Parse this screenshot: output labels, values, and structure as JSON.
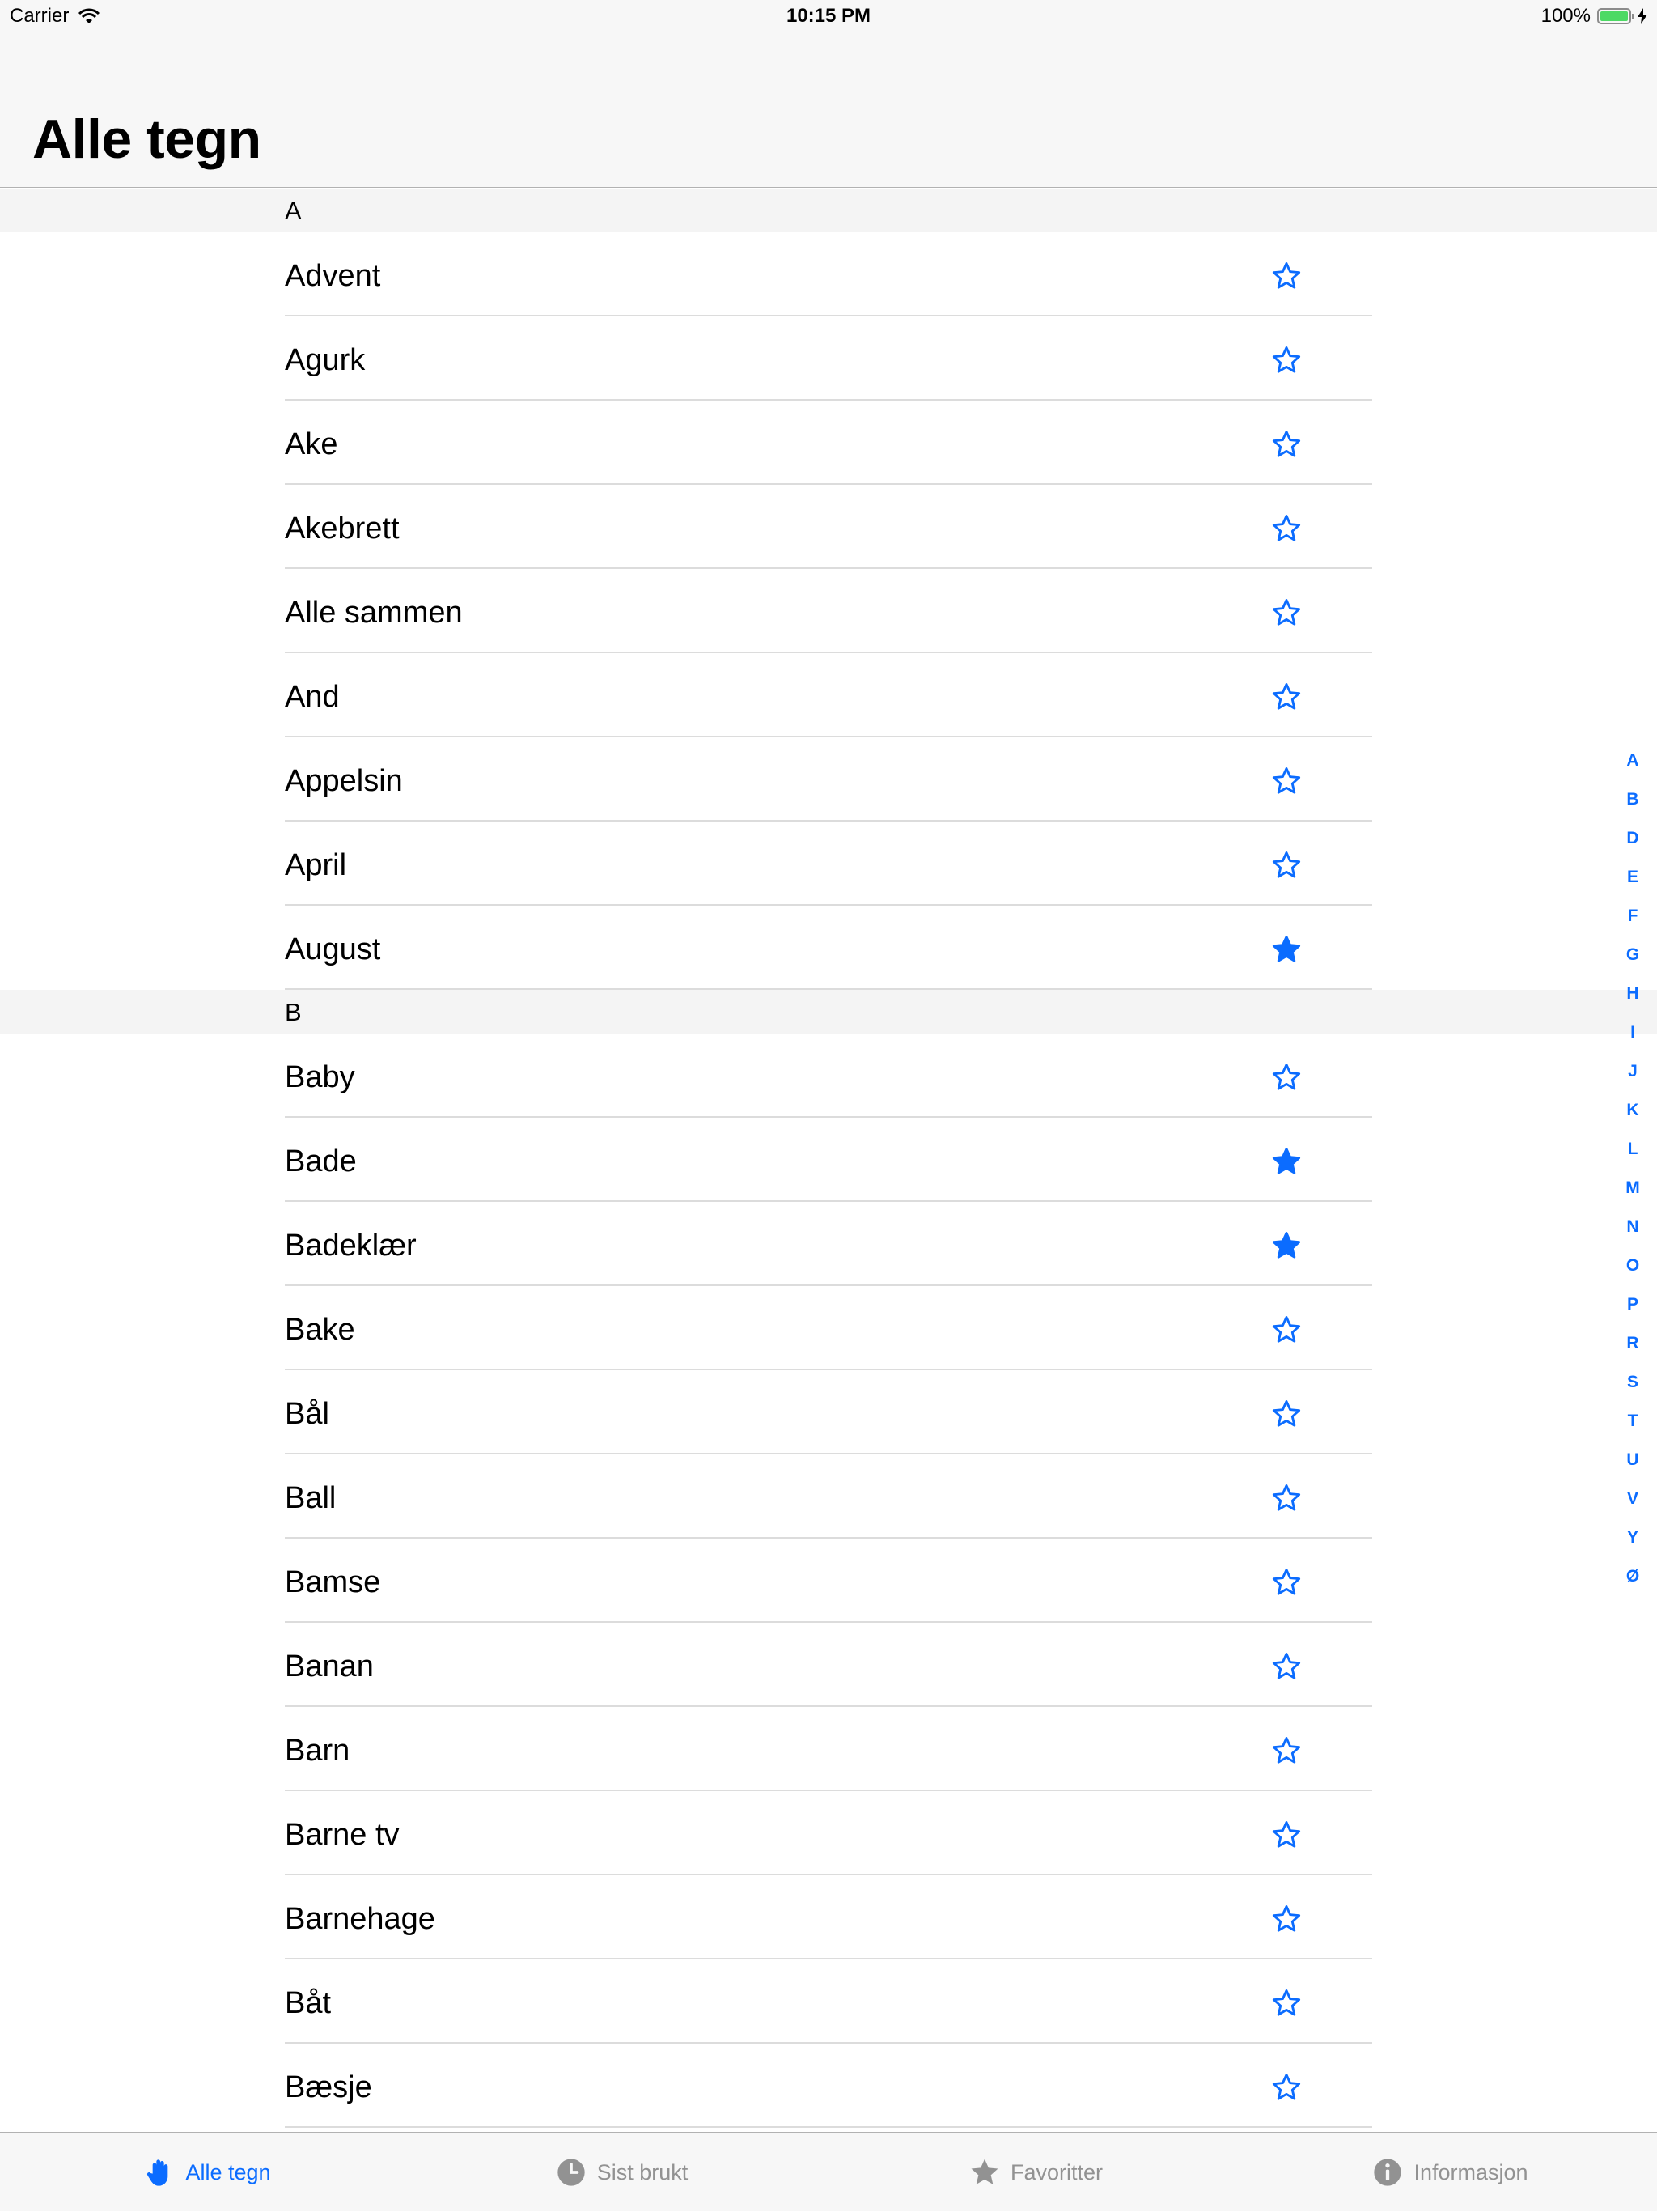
{
  "status_bar": {
    "carrier": "Carrier",
    "time": "10:15 PM",
    "battery": "100%",
    "battery_level": 1.0
  },
  "nav": {
    "title": "Alle tegn"
  },
  "colors": {
    "accent": "#0b6cff",
    "battery": "#4cd964",
    "separator": "#dcdcdc",
    "section_bg": "#f4f4f4"
  },
  "sections": [
    {
      "letter": "A",
      "items": [
        {
          "label": "Advent",
          "favorite": false
        },
        {
          "label": "Agurk",
          "favorite": false
        },
        {
          "label": "Ake",
          "favorite": false
        },
        {
          "label": "Akebrett",
          "favorite": false
        },
        {
          "label": "Alle sammen",
          "favorite": false
        },
        {
          "label": "And",
          "favorite": false
        },
        {
          "label": "Appelsin",
          "favorite": false
        },
        {
          "label": "April",
          "favorite": false
        },
        {
          "label": "August",
          "favorite": true
        }
      ]
    },
    {
      "letter": "B",
      "items": [
        {
          "label": "Baby",
          "favorite": false
        },
        {
          "label": "Bade",
          "favorite": true
        },
        {
          "label": "Badeklær",
          "favorite": true
        },
        {
          "label": "Bake",
          "favorite": false
        },
        {
          "label": "Bål",
          "favorite": false
        },
        {
          "label": "Ball",
          "favorite": false
        },
        {
          "label": "Bamse",
          "favorite": false
        },
        {
          "label": "Banan",
          "favorite": false
        },
        {
          "label": "Barn",
          "favorite": false
        },
        {
          "label": "Barne tv",
          "favorite": false
        },
        {
          "label": "Barnehage",
          "favorite": false
        },
        {
          "label": "Båt",
          "favorite": false
        },
        {
          "label": "Bæsje",
          "favorite": false
        }
      ]
    }
  ],
  "index": [
    "A",
    "B",
    "D",
    "E",
    "F",
    "G",
    "H",
    "I",
    "J",
    "K",
    "L",
    "M",
    "N",
    "O",
    "P",
    "R",
    "S",
    "T",
    "U",
    "V",
    "Y",
    "Ø"
  ],
  "tabs": [
    {
      "label": "Alle tegn",
      "icon": "hand-icon",
      "active": true
    },
    {
      "label": "Sist brukt",
      "icon": "clock-icon",
      "active": false
    },
    {
      "label": "Favoritter",
      "icon": "star-icon",
      "active": false
    },
    {
      "label": "Informasjon",
      "icon": "info-icon",
      "active": false
    }
  ]
}
